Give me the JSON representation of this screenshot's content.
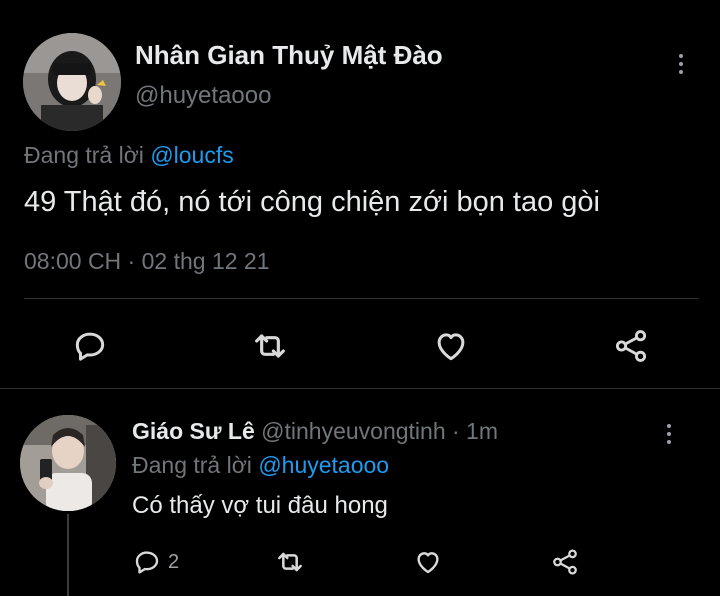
{
  "main_tweet": {
    "author_name": "Nhân Gian Thuỷ Mật Đào",
    "handle": "@huyetaooo",
    "replying_prefix": "Đang trả lời",
    "replying_to": "@loucfs",
    "text": "49 Thật đó, nó tới công chiện zới bọn tao gòi",
    "timestamp": "08:00 CH · 02 thg 12 21",
    "actions": {
      "reply": "reply-icon",
      "retweet": "retweet-icon",
      "like": "heart-icon",
      "share": "share-icon"
    }
  },
  "reply_tweet": {
    "author_name": "Giáo Sư Lê",
    "meta": "@tinhyeuvongtinh · 1m",
    "replying_prefix": "Đang trả lời",
    "replying_to": "@huyetaooo",
    "text": "Có thấy vợ tui đâu hong",
    "reply_count": "2"
  },
  "colors": {
    "background": "#000000",
    "text": "#e7e9ea",
    "muted": "#71767b",
    "link": "#1d9bf0",
    "divider": "#2f3336"
  }
}
